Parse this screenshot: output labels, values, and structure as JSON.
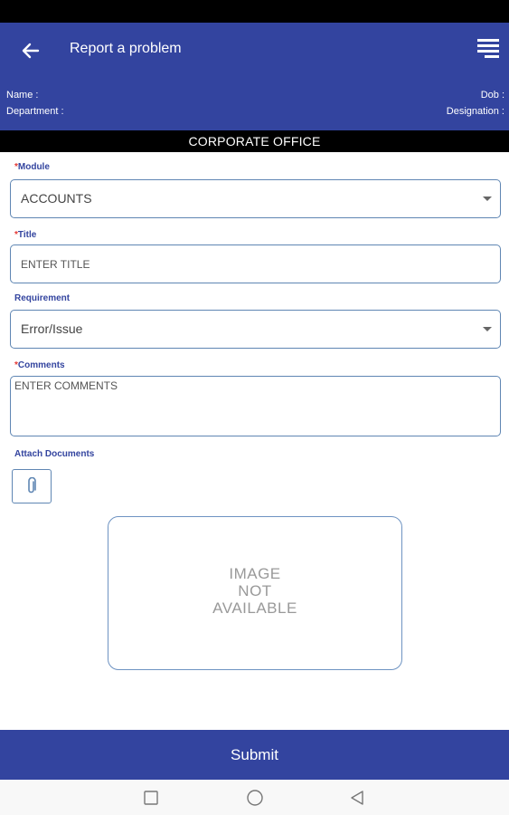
{
  "header": {
    "title": "Report a problem",
    "back_icon": "arrow-left-icon",
    "menu_icon": "menu-list-icon",
    "background": "#33449f"
  },
  "profile": {
    "name_label": "Name :",
    "department_label": "Department :",
    "dob_label": "Dob :",
    "designation_label": "Designation :"
  },
  "banner": {
    "text": "CORPORATE OFFICE"
  },
  "form": {
    "required_mark": "*",
    "module": {
      "label": "Module",
      "value": "ACCOUNTS"
    },
    "title": {
      "label": "Title",
      "placeholder": "ENTER TITLE"
    },
    "requirement": {
      "label": "Requirement",
      "value": "Error/Issue"
    },
    "comments": {
      "label": "Comments",
      "placeholder": "ENTER COMMENTS"
    },
    "attach": {
      "label": "Attach Documents",
      "icon": "paperclip-icon"
    },
    "image_preview": {
      "line1": "IMAGE",
      "line2": "NOT",
      "line3": "AVAILABLE"
    }
  },
  "submit": {
    "label": "Submit"
  },
  "navbar": {
    "recents_icon": "square-icon",
    "home_icon": "circle-icon",
    "back_icon": "triangle-back-icon"
  }
}
